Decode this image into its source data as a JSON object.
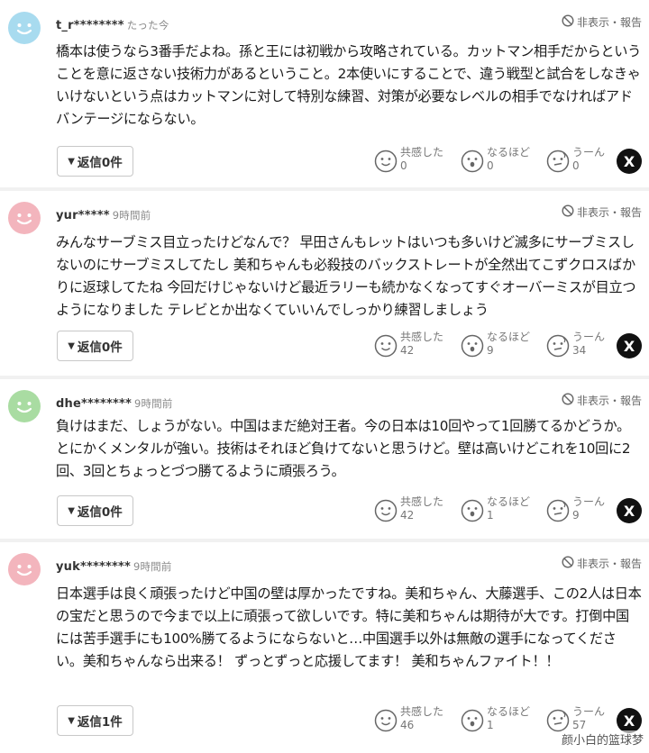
{
  "common": {
    "hide_report_label": "非表示・報告",
    "react_empathy": "共感した",
    "react_insight": "なるほど",
    "react_hmm": "うーん",
    "x_label": "X"
  },
  "comments": [
    {
      "username": "t_r********",
      "time": "たった今",
      "text": "橋本は使うなら3番手だよね。孫と王には初戦から攻略されている。カットマン相手だからということを意に返さない技術力があるということ。2本使いにすることで、違う戦型と試合をしなきゃいけないという点はカットマンに対して特別な練習、対策が必要なレベルの相手でなければアドバンテージにならない。",
      "reply_label": "返信0件",
      "empathy": "0",
      "insight": "0",
      "hmm": "0",
      "avatar_color": "#a8dbef"
    },
    {
      "username": "yur*****",
      "time": "9時間前",
      "text": "みんなサーブミス目立ったけどなんで？ 早田さんもレットはいつも多いけど滅多にサーブミスしないのにサーブミスしてたし 美和ちゃんも必殺技のバックストレートが全然出てこずクロスばかりに返球してたね 今回だけじゃないけど最近ラリーも続かなくなってすぐオーバーミスが目立つようになりました テレビとか出なくていいんでしっかり練習しましょう",
      "reply_label": "返信0件",
      "empathy": "42",
      "insight": "9",
      "hmm": "34",
      "avatar_color": "#f3b5bd"
    },
    {
      "username": "dhe********",
      "time": "9時間前",
      "text": "負けはまだ、しょうがない。中国はまだ絶対王者。今の日本は10回やって1回勝てるかどうか。とにかくメンタルが強い。技術はそれほど負けてないと思うけど。壁は高いけどこれを10回に2回、3回とちょっとづつ勝てるように頑張ろう。",
      "reply_label": "返信0件",
      "empathy": "42",
      "insight": "1",
      "hmm": "9",
      "avatar_color": "#a9dca2"
    },
    {
      "username": "yuk********",
      "time": "9時間前",
      "text": "日本選手は良く頑張ったけど中国の壁は厚かったですね。美和ちゃん、大藤選手、この2人は日本の宝だと思うので今まで以上に頑張って欲しいです。特に美和ちゃんは期待が大です。打倒中国には苦手選手にも100%勝てるようにならないと…中国選手以外は無敵の選手になってください。美和ちゃんなら出来る！ ずっとずっと応援してます！ 美和ちゃんファイト！！",
      "reply_label": "返信1件",
      "empathy": "46",
      "insight": "1",
      "hmm": "57",
      "avatar_color": "#f3b5bd"
    }
  ],
  "watermark": "颜小白的篮球梦"
}
